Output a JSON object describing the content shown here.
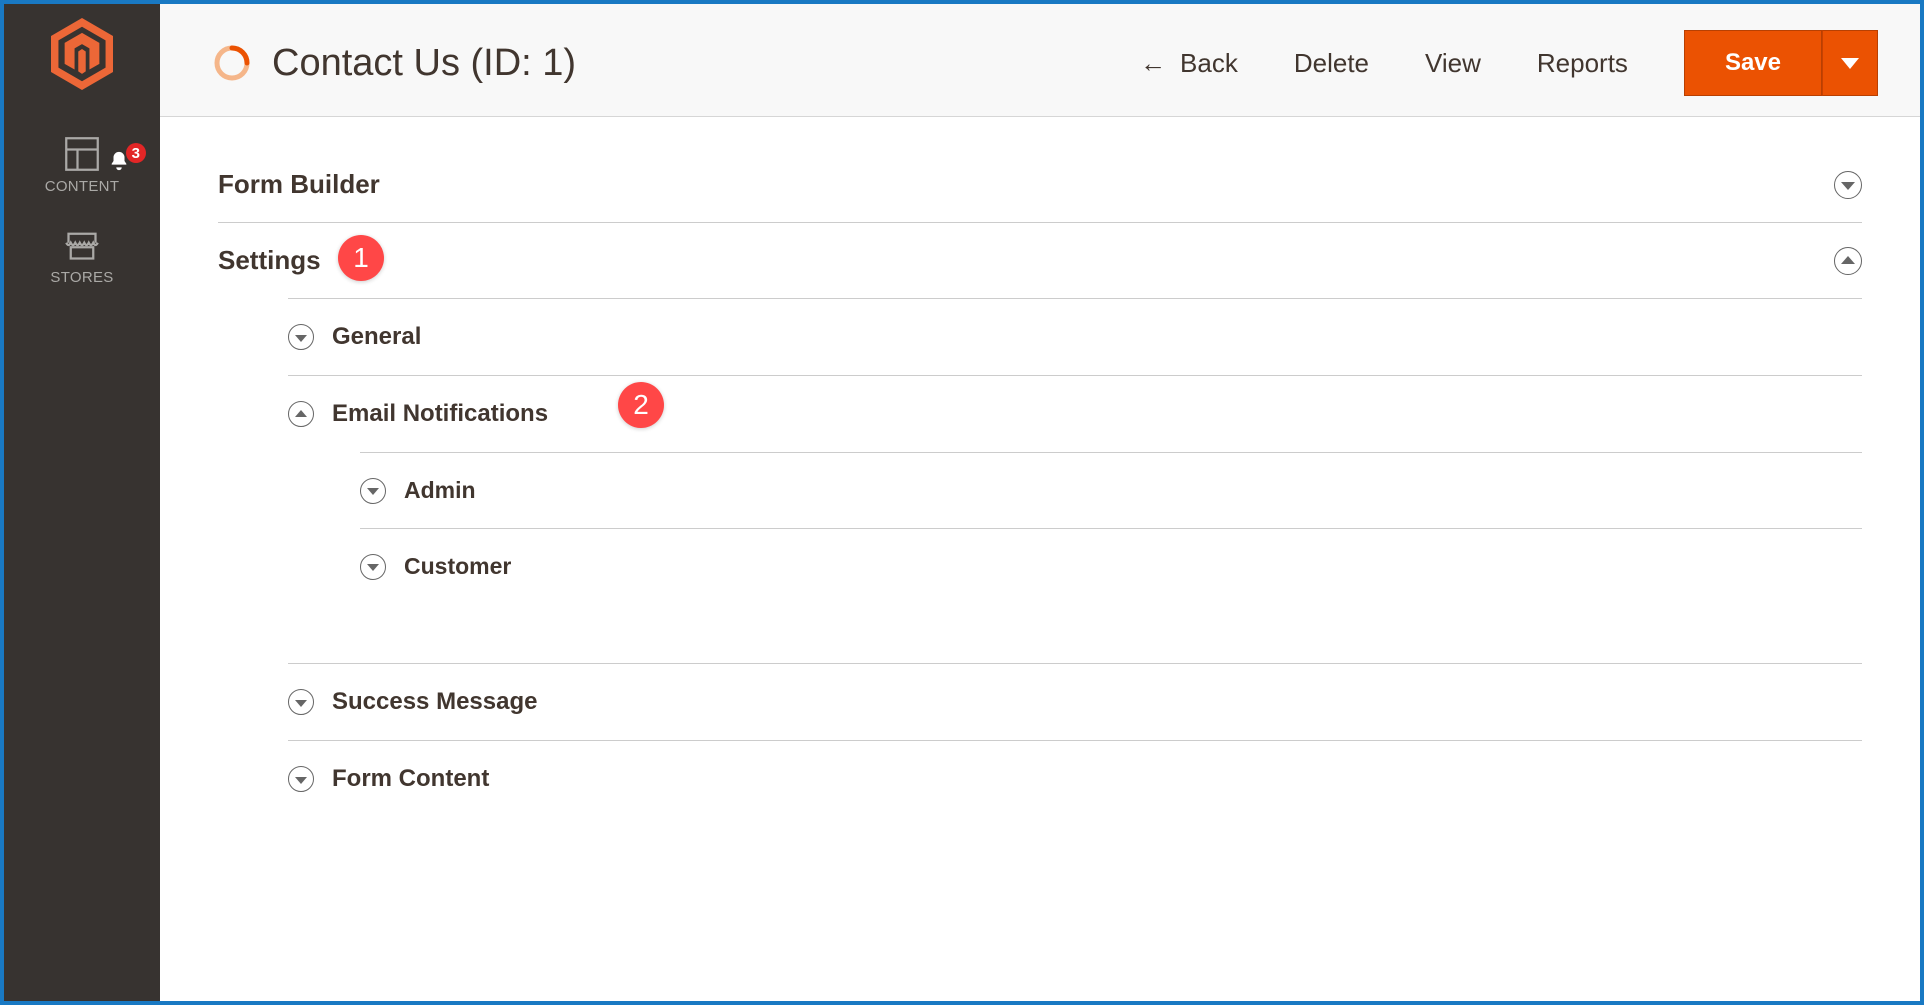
{
  "sidebar": {
    "items": [
      {
        "label": "CONTENT"
      },
      {
        "label": "STORES"
      }
    ],
    "badge_count": "3"
  },
  "header": {
    "title": "Contact Us (ID: 1)",
    "actions": {
      "back": "Back",
      "delete": "Delete",
      "view": "View",
      "reports": "Reports",
      "save": "Save"
    }
  },
  "sections": {
    "form_builder": "Form Builder",
    "settings": "Settings",
    "settings_children": {
      "general": "General",
      "email_notifications": "Email Notifications",
      "email_children": {
        "admin": "Admin",
        "customer": "Customer"
      },
      "success_message": "Success Message",
      "form_content": "Form Content"
    }
  },
  "annotations": {
    "one": "1",
    "two": "2"
  }
}
